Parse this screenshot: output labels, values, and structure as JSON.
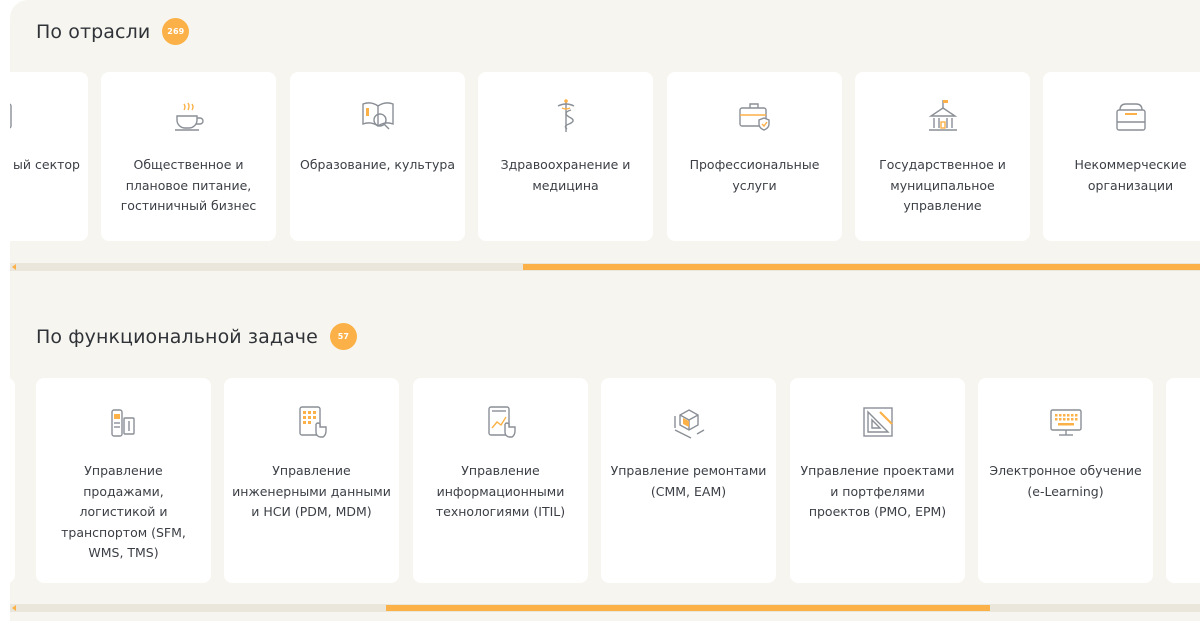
{
  "industries": {
    "title": "По отрасли",
    "count": "269",
    "cards": [
      {
        "label": "ый сектор",
        "icon": "bank-icon"
      },
      {
        "label": "Общественное и плановое питание, гостиничный бизнес",
        "icon": "teacup-icon"
      },
      {
        "label": "Образование, культура",
        "icon": "book-search-icon"
      },
      {
        "label": "Здравоохранение и медицина",
        "icon": "caduceus-icon"
      },
      {
        "label": "Профессиональные услуги",
        "icon": "briefcase-shield-icon"
      },
      {
        "label": "Государственное и муниципальное управление",
        "icon": "government-building-icon"
      },
      {
        "label": "Некоммерческие организации",
        "icon": "donation-box-icon"
      }
    ],
    "scroll_position": 0.55
  },
  "functions": {
    "title": "По функциональной задаче",
    "count": "57",
    "cards": [
      {
        "label": "",
        "icon": ""
      },
      {
        "label": "Управление продажами, логистикой и транспортом (SFM, WMS, TMS)",
        "icon": "pos-terminal-icon"
      },
      {
        "label": "Управление инженерными данными и НСИ (PDM, MDM)",
        "icon": "tablet-touch-icon"
      },
      {
        "label": "Управление информационными технологиями (ITIL)",
        "icon": "tablet-chart-touch-icon"
      },
      {
        "label": "Управление ремонтами (CMM, EAM)",
        "icon": "cube-measure-icon"
      },
      {
        "label": "Управление проектами и портфелями проектов (PMO, EPM)",
        "icon": "drafting-triangle-icon"
      },
      {
        "label": "Электронное обучение (e-Learning)",
        "icon": "monitor-keyboard-icon"
      }
    ],
    "scroll_position": 0.5
  },
  "colors": {
    "accent": "#fbb147",
    "panel": "#f7f5f0",
    "card": "#ffffff",
    "icon_stroke": "#8a8f96"
  }
}
